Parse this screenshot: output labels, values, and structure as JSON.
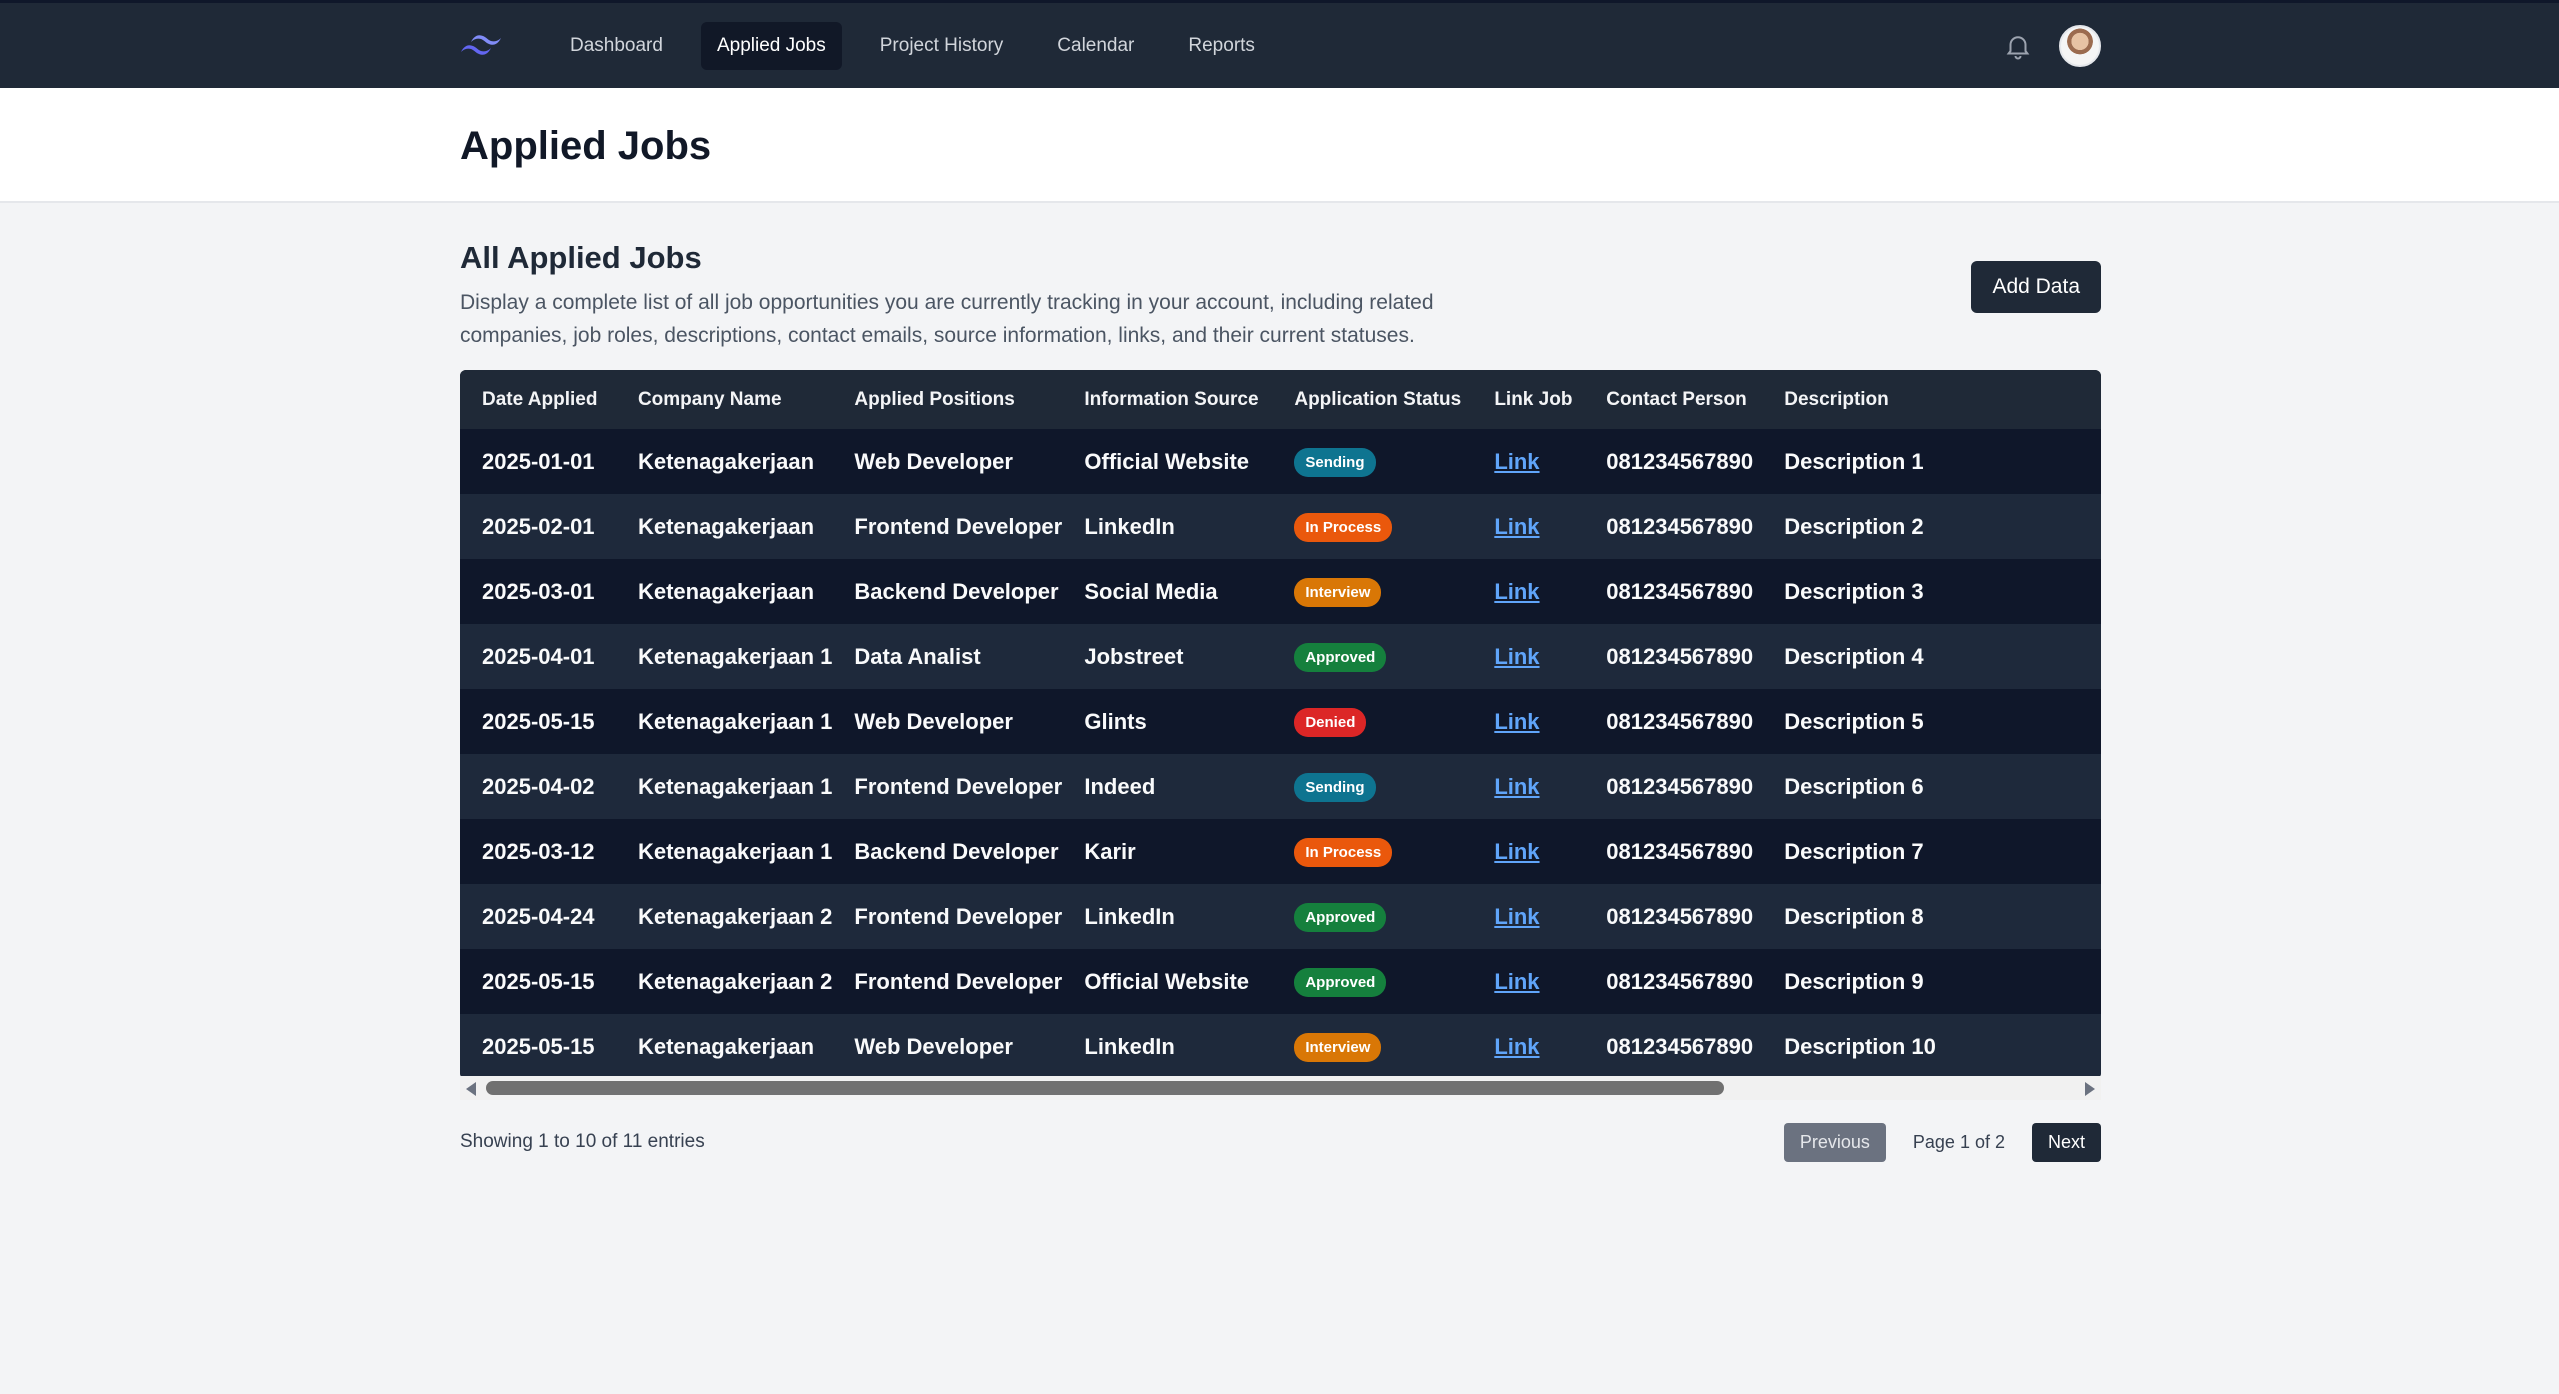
{
  "nav": {
    "logo_icon": "tailwind-logo-icon",
    "links": [
      {
        "label": "Dashboard",
        "active": false
      },
      {
        "label": "Applied Jobs",
        "active": true
      },
      {
        "label": "Project History",
        "active": false
      },
      {
        "label": "Calendar",
        "active": false
      },
      {
        "label": "Reports",
        "active": false
      }
    ],
    "bell_icon": "bell-icon"
  },
  "header": {
    "title": "Applied Jobs"
  },
  "section": {
    "title": "All Applied Jobs",
    "description": "Display a complete list of all job opportunities you are currently tracking in your account, including related companies, job roles, descriptions, contact emails, source information, links, and their current statuses.",
    "add_button": "Add Data"
  },
  "table": {
    "columns": [
      "Date Applied",
      "Company Name",
      "Applied Positions",
      "Information Source",
      "Application Status",
      "Link Job",
      "Contact Person",
      "Description"
    ],
    "rows": [
      [
        "2025-01-01",
        "Ketenagakerjaan",
        "Web Developer",
        "Official Website",
        "Sending",
        "Link",
        "081234567890",
        "Description 1"
      ],
      [
        "2025-02-01",
        "Ketenagakerjaan",
        "Frontend Developer",
        "LinkedIn",
        "In Process",
        "Link",
        "081234567890",
        "Description 2"
      ],
      [
        "2025-03-01",
        "Ketenagakerjaan",
        "Backend Developer",
        "Social Media",
        "Interview",
        "Link",
        "081234567890",
        "Description 3"
      ],
      [
        "2025-04-01",
        "Ketenagakerjaan 1",
        "Data Analist",
        "Jobstreet",
        "Approved",
        "Link",
        "081234567890",
        "Description 4"
      ],
      [
        "2025-05-15",
        "Ketenagakerjaan 1",
        "Web Developer",
        "Glints",
        "Denied",
        "Link",
        "081234567890",
        "Description 5"
      ],
      [
        "2025-04-02",
        "Ketenagakerjaan 1",
        "Frontend Developer",
        "Indeed",
        "Sending",
        "Link",
        "081234567890",
        "Description 6"
      ],
      [
        "2025-03-12",
        "Ketenagakerjaan 1",
        "Backend Developer",
        "Karir",
        "In Process",
        "Link",
        "081234567890",
        "Description 7"
      ],
      [
        "2025-04-24",
        "Ketenagakerjaan 2",
        "Frontend Developer",
        "LinkedIn",
        "Approved",
        "Link",
        "081234567890",
        "Description 8"
      ],
      [
        "2025-05-15",
        "Ketenagakerjaan 2",
        "Frontend Developer",
        "Official Website",
        "Approved",
        "Link",
        "081234567890",
        "Description 9"
      ],
      [
        "2025-05-15",
        "Ketenagakerjaan",
        "Web Developer",
        "LinkedIn",
        "Interview",
        "Link",
        "081234567890",
        "Description 10"
      ]
    ],
    "status_colors": {
      "Sending": "#0e7490",
      "In Process": "#ea580c",
      "Interview": "#d97706",
      "Approved": "#15803d",
      "Denied": "#dc2626"
    }
  },
  "footer": {
    "showing": "Showing 1 to 10 of 11 entries",
    "previous": "Previous",
    "page_info": "Page 1 of 2",
    "next": "Next"
  }
}
